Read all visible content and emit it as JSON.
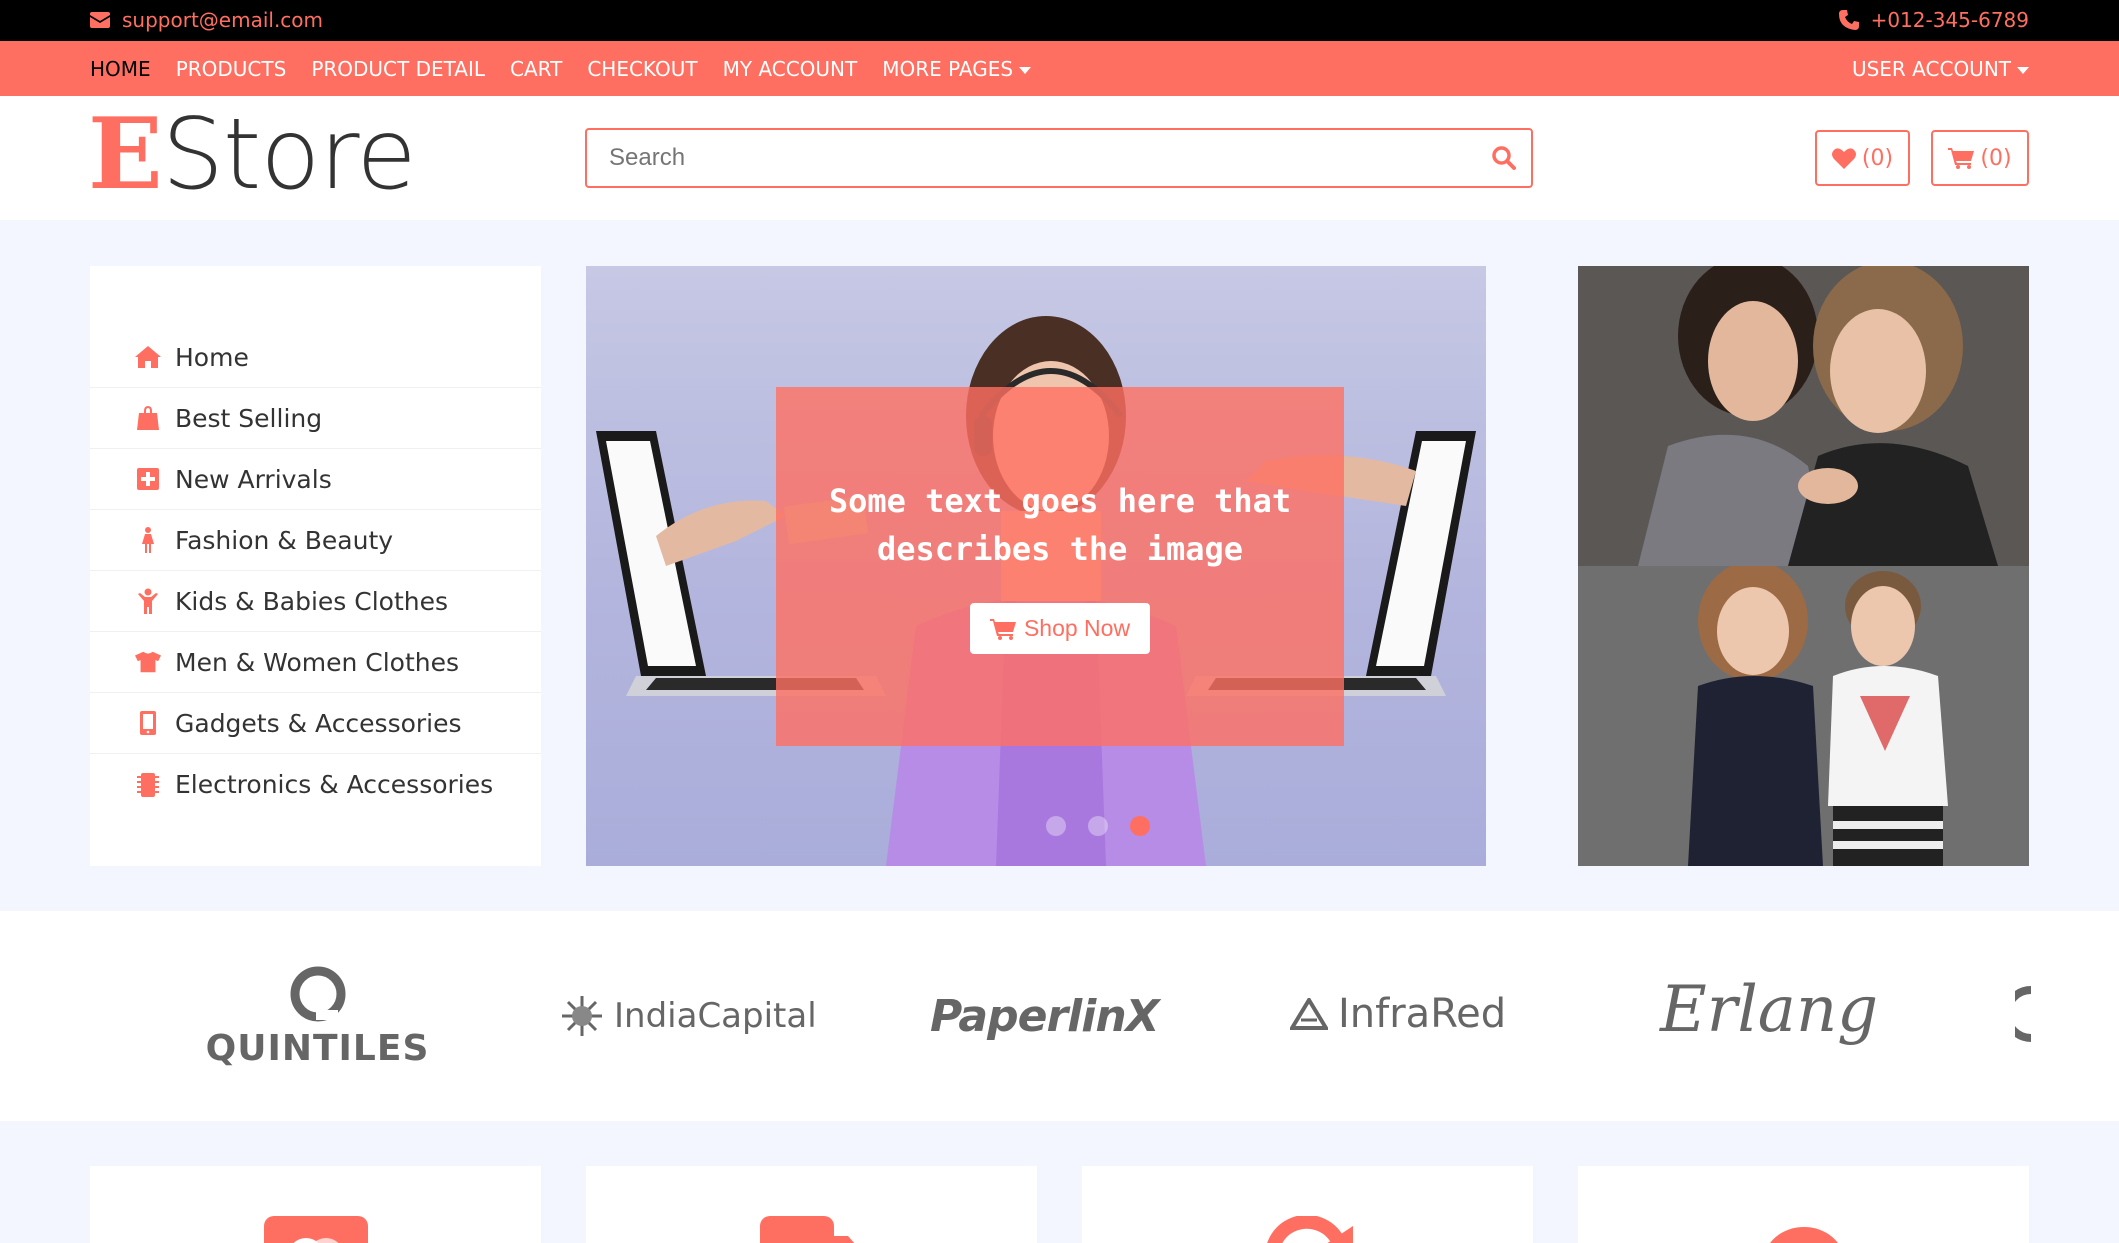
{
  "topbar": {
    "email": "support@email.com",
    "phone": "+012-345-6789"
  },
  "nav": {
    "items": [
      {
        "label": "HOME",
        "active": true
      },
      {
        "label": "PRODUCTS"
      },
      {
        "label": "PRODUCT DETAIL"
      },
      {
        "label": "CART"
      },
      {
        "label": "CHECKOUT"
      },
      {
        "label": "MY ACCOUNT"
      },
      {
        "label": "MORE PAGES"
      }
    ],
    "user_account": "USER ACCOUNT"
  },
  "header": {
    "logo_initial": "E",
    "logo_rest": "Store",
    "search_placeholder": "Search",
    "wishlist_count": "(0)",
    "cart_count": "(0)"
  },
  "sidebar": {
    "items": [
      {
        "label": "Home",
        "icon": "home-icon"
      },
      {
        "label": "Best Selling",
        "icon": "shopping-bag-icon"
      },
      {
        "label": "New Arrivals",
        "icon": "plus-square-icon"
      },
      {
        "label": "Fashion & Beauty",
        "icon": "female-icon"
      },
      {
        "label": "Kids & Babies Clothes",
        "icon": "child-icon"
      },
      {
        "label": "Men & Women Clothes",
        "icon": "tshirt-icon"
      },
      {
        "label": "Gadgets & Accessories",
        "icon": "mobile-icon"
      },
      {
        "label": "Electronics & Accessories",
        "icon": "microchip-icon"
      }
    ]
  },
  "slider": {
    "caption": "Some text goes here that describes the image",
    "button": "Shop Now",
    "active_slide": 3
  },
  "brands": {
    "items": [
      "QUINTILES",
      "IndiaCapital",
      "PaperlinX",
      "InfraRed",
      "Erlang"
    ]
  },
  "colors": {
    "accent": "#ff6f61",
    "topbar": "#000000",
    "page_bg": "#f3f6ff"
  }
}
